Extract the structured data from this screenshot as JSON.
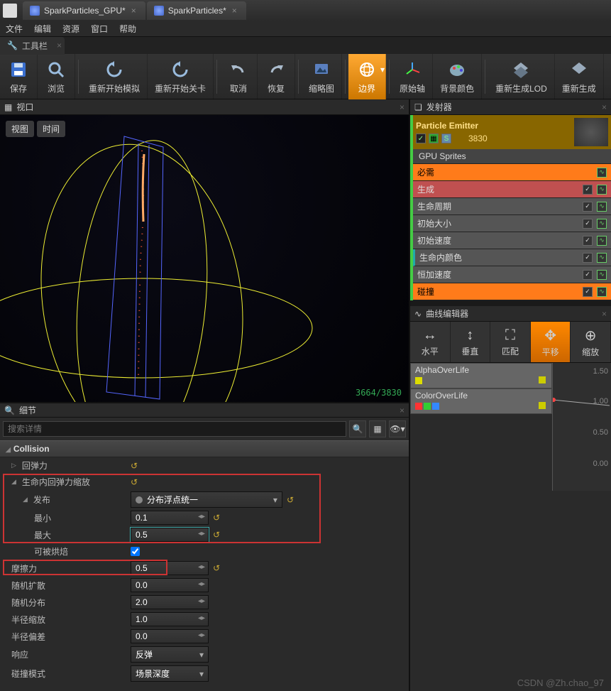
{
  "tabs": [
    {
      "name": "SparkParticles_GPU*"
    },
    {
      "name": "SparkParticles*"
    }
  ],
  "menu": [
    "文件",
    "编辑",
    "资源",
    "窗口",
    "帮助"
  ],
  "toolbarTab": "工具栏",
  "toolbar": [
    {
      "label": "保存",
      "icon": "save"
    },
    {
      "label": "浏览",
      "icon": "search"
    },
    {
      "label": "重新开始模拟",
      "icon": "restart-sim"
    },
    {
      "label": "重新开始关卡",
      "icon": "restart-level"
    },
    {
      "label": "取消",
      "icon": "undo"
    },
    {
      "label": "恢复",
      "icon": "redo"
    },
    {
      "label": "缩略图",
      "icon": "thumbnail"
    },
    {
      "label": "边界",
      "icon": "bounds",
      "active": true
    },
    {
      "label": "原始轴",
      "icon": "axis"
    },
    {
      "label": "背景颜色",
      "icon": "bgcolor"
    },
    {
      "label": "重新生成LOD",
      "icon": "lod"
    },
    {
      "label": "重新生成",
      "icon": "regen"
    }
  ],
  "viewportTab": "视口",
  "viewportBtns": {
    "view": "视图",
    "time": "时间"
  },
  "viewportStats": "3664/3830",
  "detailsTab": "细节",
  "searchPlaceholder": "搜索详情",
  "category": "Collision",
  "props": {
    "resilience": "回弹力",
    "resiliencePerLife": "生命内回弹力缩放",
    "distrib": "发布",
    "distribValue": "分布浮点统一",
    "min": "最小",
    "minValue": "0.1",
    "max": "最大",
    "maxValue": "0.5",
    "bakeable": "可被烘焙",
    "friction": "摩擦力",
    "frictionValue": "0.5",
    "randomSpread": "随机扩散",
    "randomSpreadValue": "0.0",
    "randomDistrib": "随机分布",
    "randomDistribValue": "2.0",
    "radiusScale": "半径缩放",
    "radiusScaleValue": "1.0",
    "radiusBias": "半径偏差",
    "radiusBiasValue": "0.0",
    "response": "响应",
    "responseValue": "反弹",
    "collisionMode": "碰撞模式",
    "collisionModeValue": "场景深度"
  },
  "emitterTab": "发射器",
  "emitter": {
    "name": "Particle Emitter",
    "count": "3830",
    "gpu": "GPU Sprites"
  },
  "modules": [
    {
      "label": "必需",
      "cls": "mod-orange",
      "curve": true
    },
    {
      "label": "生成",
      "cls": "mod-red",
      "check": true,
      "curve": true
    },
    {
      "label": "生命周期",
      "cls": "mod-gray",
      "check": true,
      "curve": true
    },
    {
      "label": "初始大小",
      "cls": "mod-gray",
      "check": true,
      "curve": true
    },
    {
      "label": "初始速度",
      "cls": "mod-gray",
      "check": true,
      "curve": true
    },
    {
      "label": "生命内颜色",
      "cls": "mod-gray mod-teal",
      "check": true,
      "curve": true
    },
    {
      "label": "恒加速度",
      "cls": "mod-gray",
      "check": true,
      "curve": true
    },
    {
      "label": "碰撞",
      "cls": "mod-orange",
      "check": true,
      "curve": true
    }
  ],
  "curveTab": "曲线编辑器",
  "curveToolbar": [
    {
      "label": "水平",
      "icon": "horiz"
    },
    {
      "label": "垂直",
      "icon": "vert"
    },
    {
      "label": "匹配",
      "icon": "fit"
    },
    {
      "label": "平移",
      "icon": "pan",
      "active": true
    },
    {
      "label": "缩放",
      "icon": "zoom"
    }
  ],
  "curves": [
    {
      "name": "AlphaOverLife",
      "colors": [
        "#dddd00"
      ]
    },
    {
      "name": "ColorOverLife",
      "colors": [
        "#ff3333",
        "#33cc33",
        "#3388ff"
      ]
    }
  ],
  "axisTicks": [
    "1.50",
    "1.00",
    "0.50",
    "0.00"
  ],
  "watermark": "CSDN @Zh.chao_97"
}
